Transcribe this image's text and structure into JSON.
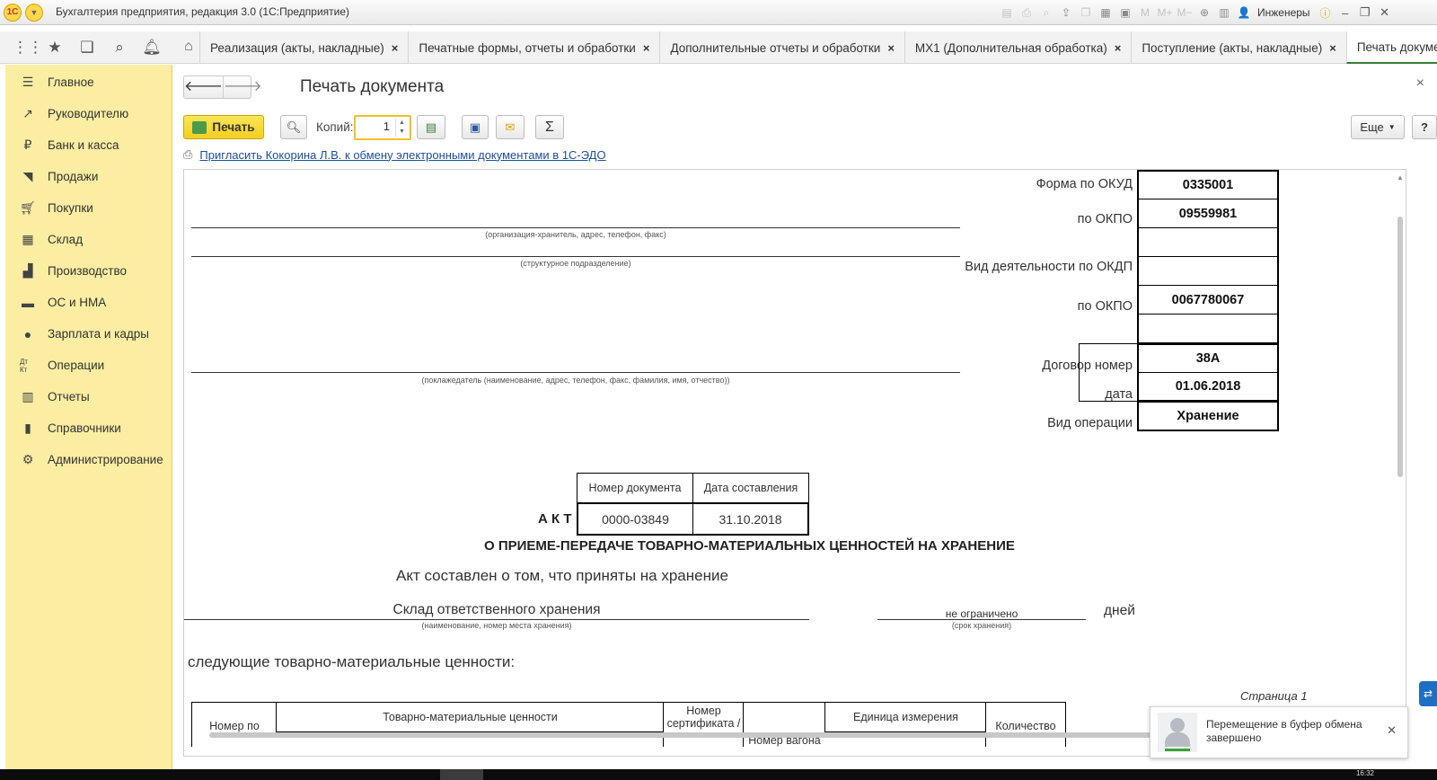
{
  "window": {
    "title": "Бухгалтерия предприятия, редакция 3.0  (1С:Предприятие)",
    "user": "Инженеры",
    "logo": "1С"
  },
  "tabs": [
    {
      "label": "Реализация (акты, накладные)"
    },
    {
      "label": "Печатные формы, отчеты и обработки"
    },
    {
      "label": "Дополнительные отчеты и обработки"
    },
    {
      "label": "МХ1 (Дополнительная обработка)"
    },
    {
      "label": "Поступление (акты, накладные)"
    },
    {
      "label": "Печать документа"
    }
  ],
  "sidebar": {
    "items": [
      {
        "label": "Главное",
        "icon": "menu-icon"
      },
      {
        "label": "Руководителю",
        "icon": "trend-icon"
      },
      {
        "label": "Банк и касса",
        "icon": "ruble-icon"
      },
      {
        "label": "Продажи",
        "icon": "sales-icon"
      },
      {
        "label": "Покупки",
        "icon": "cart-icon"
      },
      {
        "label": "Склад",
        "icon": "warehouse-icon"
      },
      {
        "label": "Производство",
        "icon": "factory-icon"
      },
      {
        "label": "ОС и НМА",
        "icon": "truck-icon"
      },
      {
        "label": "Зарплата и кадры",
        "icon": "person-icon"
      },
      {
        "label": "Операции",
        "icon": "dtkt-icon"
      },
      {
        "label": "Отчеты",
        "icon": "chart-icon"
      },
      {
        "label": "Справочники",
        "icon": "book-icon"
      },
      {
        "label": "Администрирование",
        "icon": "gear-icon"
      }
    ]
  },
  "form": {
    "title": "Печать документа",
    "print_label": "Печать",
    "copies_label": "Копий:",
    "copies_value": "1",
    "more_label": "Еще",
    "help_label": "?",
    "edo_link": "Пригласить Кокорина Л.В. к обмену электронными документами в 1С-ЭДО"
  },
  "doc": {
    "cap_org": "(организация-хранитель, адрес, телефон, факс)",
    "cap_dept": "(структурное подразделение)",
    "cap_client": "(поклажедатель (наименование, адрес, телефон, факс, фамилия, имя, отчество))",
    "lbl_okud": "Форма по ОКУД",
    "val_okud": "0335001",
    "lbl_okpo1": "по ОКПО",
    "val_okpo1": "09559981",
    "lbl_okdp": "Вид деятельности по ОКДП",
    "lbl_okpo2": "по ОКПО",
    "val_okpo2": "0067780067",
    "lbl_contract": "Договор",
    "lbl_number": "номер",
    "val_number": "38А",
    "lbl_date": "дата",
    "val_date": "01.06.2018",
    "lbl_optype": "Вид операции",
    "val_optype": "Хранение",
    "th_docnum": "Номер документа",
    "th_docdate": "Дата составления",
    "act_label": "А К Т",
    "val_docnum": "0000-03849",
    "val_docdate": "31.10.2018",
    "heading": "О ПРИЕМЕ-ПЕРЕДАЧЕ ТОВАРНО-МАТЕРИАЛЬНЫХ ЦЕННОСТЕЙ НА ХРАНЕНИЕ",
    "line_accepted": "Акт составлен о том, что приняты на хранение",
    "storage_place": "Склад ответственного хранения",
    "cap_place": "(наименование, номер места хранения)",
    "term": "не ограничено",
    "cap_term": "(срок хранения)",
    "days": "дней",
    "following": "следующие товарно-материальные ценности:",
    "page_label": "Страница 1",
    "table_headers": [
      "Номер по",
      "Товарно-материальные ценности",
      "Номер сертификата /",
      "Номер вагона",
      "Единица измерения",
      "Количество"
    ]
  },
  "notification": {
    "text": "Перемещение в буфер обмена завершено"
  },
  "taskbar": {
    "clock": "16:32"
  }
}
